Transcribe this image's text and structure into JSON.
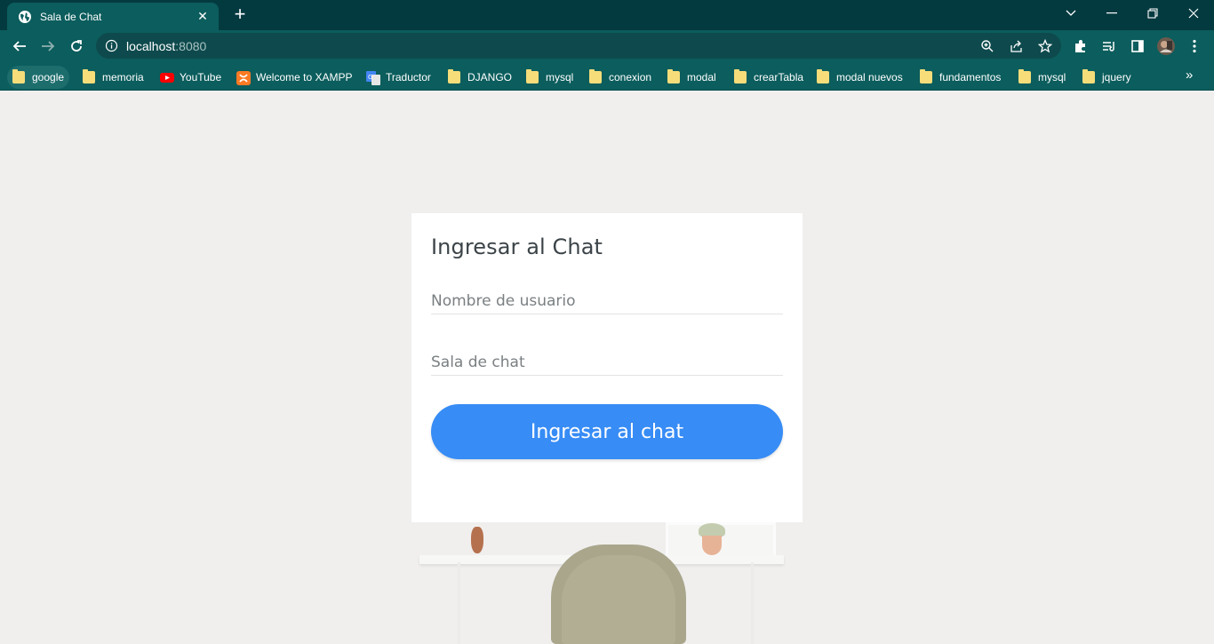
{
  "browser": {
    "tab_title": "Sala de Chat",
    "url_host": "localhost",
    "url_port": ":8080",
    "colors": {
      "titlebar": "#033a40",
      "toolbar": "#0c5d5d"
    }
  },
  "bookmarks": [
    {
      "label": "google",
      "icon": "folder-icon"
    },
    {
      "label": "memoria",
      "icon": "folder-icon"
    },
    {
      "label": "YouTube",
      "icon": "youtube-icon"
    },
    {
      "label": "Welcome to XAMPP",
      "icon": "xampp-icon"
    },
    {
      "label": "Traductor",
      "icon": "translate-icon"
    },
    {
      "label": "DJANGO",
      "icon": "folder-icon"
    },
    {
      "label": "mysql",
      "icon": "folder-icon"
    },
    {
      "label": "conexion",
      "icon": "folder-icon"
    },
    {
      "label": "modal",
      "icon": "folder-icon"
    },
    {
      "label": "crearTabla",
      "icon": "folder-icon"
    },
    {
      "label": "modal nuevos",
      "icon": "folder-icon"
    },
    {
      "label": "fundamentos",
      "icon": "folder-icon"
    },
    {
      "label": "mysql",
      "icon": "folder-icon"
    },
    {
      "label": "jquery",
      "icon": "folder-icon"
    }
  ],
  "login": {
    "title": "Ingresar al Chat",
    "username_placeholder": "Nombre de usuario",
    "room_placeholder": "Sala de chat",
    "submit_label": "Ingresar al chat",
    "accent": "#378cf5"
  }
}
